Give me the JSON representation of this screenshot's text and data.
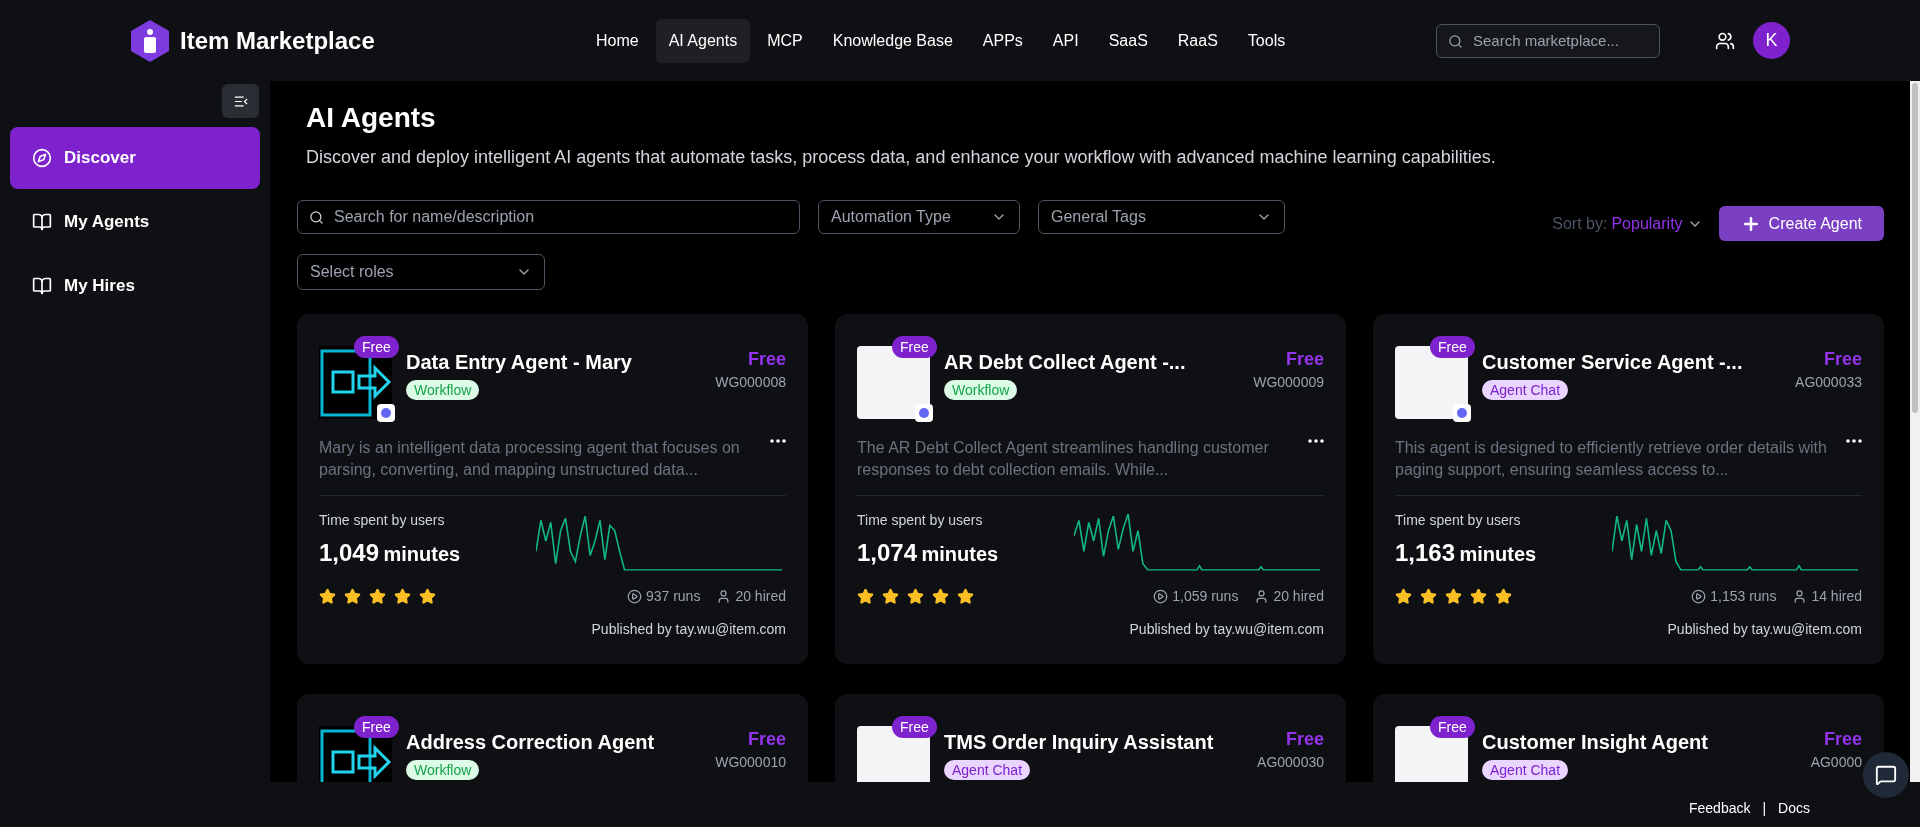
{
  "header": {
    "brand": "Item Marketplace",
    "nav": [
      {
        "label": "Home",
        "selected": false
      },
      {
        "label": "AI Agents",
        "selected": true
      },
      {
        "label": "MCP",
        "selected": false
      },
      {
        "label": "Knowledge Base",
        "selected": false
      },
      {
        "label": "APPs",
        "selected": false
      },
      {
        "label": "API",
        "selected": false
      },
      {
        "label": "SaaS",
        "selected": false
      },
      {
        "label": "RaaS",
        "selected": false
      },
      {
        "label": "Tools",
        "selected": false
      }
    ],
    "search": {
      "placeholder": "Search marketplace..."
    },
    "avatar": "K"
  },
  "sidebar": {
    "items": [
      {
        "label": "Discover",
        "selected": true,
        "kind": "compass"
      },
      {
        "label": "My Agents",
        "selected": false,
        "kind": "book"
      },
      {
        "label": "My Hires",
        "selected": false,
        "kind": "book"
      }
    ]
  },
  "page": {
    "title": "AI Agents",
    "description": "Discover and deploy intelligent AI agents that automate tasks, process data, and enhance your workflow with advanced machine learning capabilities."
  },
  "filters": {
    "search": {
      "placeholder": "Search for name/description"
    },
    "dropdowns": [
      "Automation Type",
      "General Tags"
    ],
    "roles": "Select roles",
    "sort_label": "Sort by:",
    "sort_value": "Popularity",
    "create_button": "Create Agent"
  },
  "cards": [
    {
      "title": "Data Entry Agent - Mary",
      "badge": "Free",
      "kind": "drawing",
      "tag": {
        "label": "Workflow",
        "kind": "workflow"
      },
      "price": "Free",
      "code": "WG000008",
      "description": "Mary is an intelligent data processing agent that focuses on parsing, converting, and mapping unstructured data...",
      "time_label": "Time spent by users",
      "time_number": "1,049",
      "time_unit": "minutes",
      "stars": 5,
      "runs": "937 runs",
      "hired": "20 hired",
      "publisher": "Published by tay.wu@item.com"
    },
    {
      "title": "AR Debt Collect Agent -...",
      "badge": "Free",
      "kind": "photo",
      "tag": {
        "label": "Workflow",
        "kind": "workflow"
      },
      "price": "Free",
      "code": "WG000009",
      "description": "The AR Debt Collect Agent streamlines handling customer responses to debt collection emails. While...",
      "time_label": "Time spent by users",
      "time_number": "1,074",
      "time_unit": "minutes",
      "stars": 5,
      "runs": "1,059 runs",
      "hired": "20 hired",
      "publisher": "Published by tay.wu@item.com"
    },
    {
      "title": "Customer Service Agent -...",
      "badge": "Free",
      "kind": "photo",
      "tag": {
        "label": "Agent Chat",
        "kind": "chat"
      },
      "price": "Free",
      "code": "AG000033",
      "description": "This agent is designed to efficiently retrieve order details with paging support, ensuring seamless access to...",
      "time_label": "Time spent by users",
      "time_number": "1,163",
      "time_unit": "minutes",
      "stars": 5,
      "runs": "1,153 runs",
      "hired": "14 hired",
      "publisher": "Published by tay.wu@item.com"
    },
    {
      "title": "Address Correction Agent",
      "badge": "Free",
      "kind": "drawing",
      "tag": {
        "label": "Workflow",
        "kind": "workflow"
      },
      "price": "Free",
      "code": "WG000010"
    },
    {
      "title": "TMS Order Inquiry Assistant",
      "badge": "Free",
      "kind": "photo",
      "tag": {
        "label": "Agent Chat",
        "kind": "chat"
      },
      "price": "Free",
      "code": "AG000030"
    },
    {
      "title": "Customer Insight Agent",
      "badge": "Free",
      "kind": "photo",
      "tag": {
        "label": "Agent Chat",
        "kind": "chat"
      },
      "price": "Free",
      "code": "AG0000"
    }
  ],
  "footer": {
    "links": [
      "Feedback",
      "Docs"
    ],
    "separator": "|"
  }
}
